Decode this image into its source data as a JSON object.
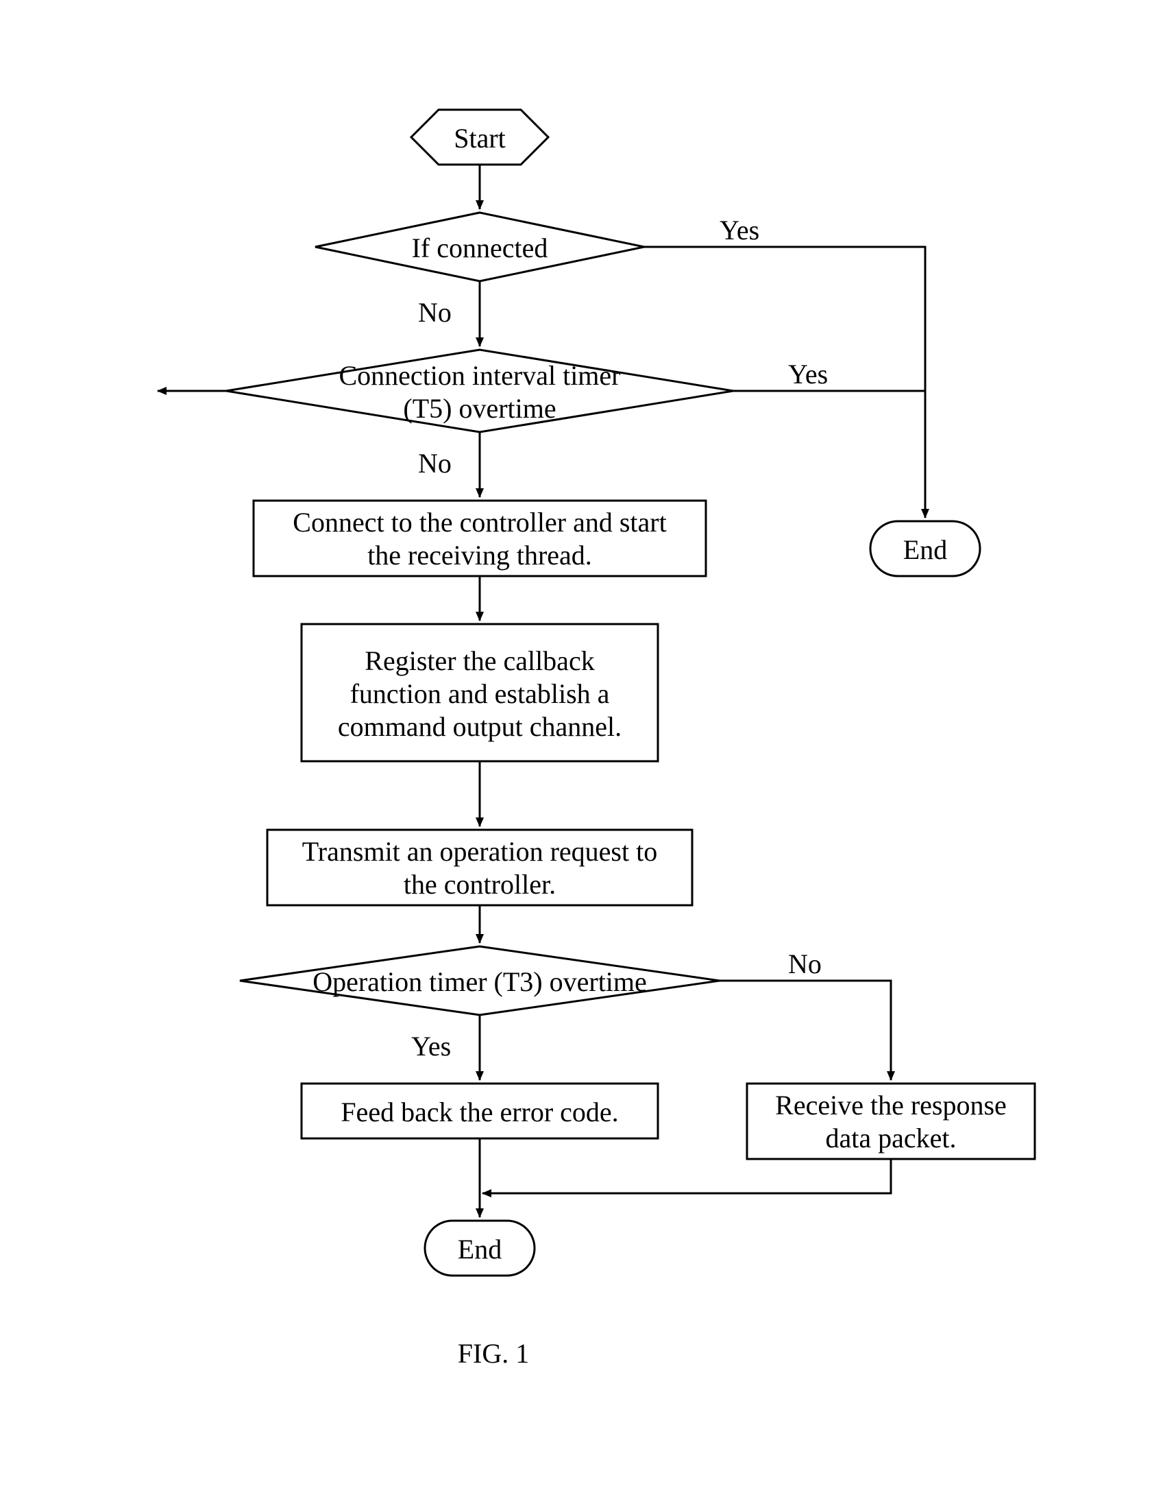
{
  "nodes": {
    "start": "Start",
    "ifConnected": "If connected",
    "t5": "Connection interval timer\n(T5) overtime",
    "connect": "Connect to the controller and start\nthe receiving thread.",
    "register": "Register the callback\nfunction and establish a\ncommand output channel.",
    "transmit": "Transmit an operation request to\nthe controller.",
    "t3": "Operation timer (T3) overtime",
    "feedback": "Feed back the error code.",
    "receive": "Receive the response\ndata packet.",
    "end1": "End",
    "end2": "End"
  },
  "labels": {
    "yes": "Yes",
    "no": "No"
  },
  "caption": "FIG. 1"
}
